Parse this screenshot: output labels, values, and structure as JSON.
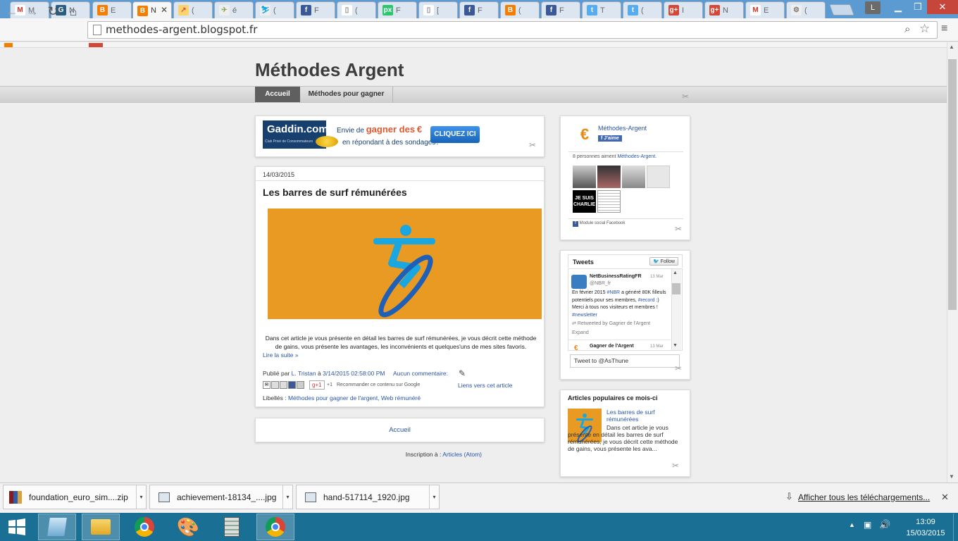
{
  "browser": {
    "tabs": [
      {
        "fav": "gmail-icon",
        "letter": "M",
        "color": "#ffffff",
        "fg": "#d93025",
        "title": "M"
      },
      {
        "fav": "goodreads-icon",
        "letter": "G",
        "color": "#2b5d80",
        "fg": "#fff",
        "title": "N"
      },
      {
        "fav": "blogger-icon",
        "letter": "B",
        "color": "#f57d00",
        "fg": "#fff",
        "title": "E"
      },
      {
        "fav": "blogger-icon",
        "letter": "B",
        "color": "#f57d00",
        "fg": "#fff",
        "title": "N"
      },
      {
        "fav": "chart-icon",
        "letter": "↗",
        "color": "#ffd36b",
        "fg": "#c55",
        "title": "("
      },
      {
        "fav": "plane-icon",
        "letter": "✈",
        "color": "#eee",
        "fg": "#8a6",
        "title": "é"
      },
      {
        "fav": "surf-icon",
        "letter": "⛷",
        "color": "#eee",
        "fg": "#1aa7e0",
        "title": "("
      },
      {
        "fav": "facebook-icon",
        "letter": "f",
        "color": "#3b5998",
        "fg": "#fff",
        "title": "F"
      },
      {
        "fav": "page-icon",
        "letter": "▯",
        "color": "#fff",
        "fg": "#888",
        "title": "("
      },
      {
        "fav": "pixabay-icon",
        "letter": "px",
        "color": "#2ec66d",
        "fg": "#fff",
        "title": "F"
      },
      {
        "fav": "page-icon",
        "letter": "▯",
        "color": "#fff",
        "fg": "#888",
        "title": "["
      },
      {
        "fav": "facebook-icon",
        "letter": "f",
        "color": "#3b5998",
        "fg": "#fff",
        "title": "F"
      },
      {
        "fav": "blogger-icon",
        "letter": "B",
        "color": "#f57d00",
        "fg": "#fff",
        "title": "("
      },
      {
        "fav": "facebook-icon",
        "letter": "f",
        "color": "#3b5998",
        "fg": "#fff",
        "title": "F"
      },
      {
        "fav": "twitter-icon",
        "letter": "t",
        "color": "#55acee",
        "fg": "#fff",
        "title": "T"
      },
      {
        "fav": "twitter-icon",
        "letter": "t",
        "color": "#55acee",
        "fg": "#fff",
        "title": "("
      },
      {
        "fav": "googleplus-icon",
        "letter": "g+",
        "color": "#d34836",
        "fg": "#fff",
        "title": "I"
      },
      {
        "fav": "googleplus-icon",
        "letter": "g+",
        "color": "#d34836",
        "fg": "#fff",
        "title": "N"
      },
      {
        "fav": "gmail-icon",
        "letter": "M",
        "color": "#fff",
        "fg": "#d93025",
        "title": "E"
      },
      {
        "fav": "settings-icon",
        "letter": "⚙",
        "color": "#eee",
        "fg": "#777",
        "title": "("
      }
    ],
    "user_badge": "L",
    "url": "methodes-argent.blogspot.fr"
  },
  "blog": {
    "title": "Méthodes Argent",
    "nav": {
      "home": "Accueil",
      "methods": "Méthodes pour gagner"
    },
    "ad": {
      "brand": "Gaddin.com",
      "tagline": "Club Privé de Consommateurs",
      "line1_prefix": "Envie de ",
      "line1_highlight": "gagner des",
      "line1_euro": "€",
      "line2": "en répondant à des sondages?",
      "button": "CLIQUEZ ICI"
    },
    "post": {
      "date": "14/03/2015",
      "title": "Les barres de surf rémunérées",
      "excerpt": "Dans cet article je vous présente en détail les barres de surf rémunérées, je vous décrit cette méthode de gains, vous présente les avantages, les inconvénients et quelques'uns de mes sites favoris.",
      "read_more": "Lire la suite »",
      "published_by": "Publié par",
      "author": "L. Tristan",
      "at": "à",
      "time": "3/14/2015 02:58:00 PM",
      "comments": "Aucun commentaire:",
      "gplus": "g+1",
      "plus_one": "+1",
      "recommend": "Recommander ce contenu sur Google",
      "links_to": "Liens vers cet article",
      "labels_prefix": "Libellés :",
      "label1": "Méthodes pour gagner de l'argent,",
      "label2": "Web rémunéré"
    },
    "home_link": "Accueil",
    "subscribe_prefix": "Inscription à :",
    "subscribe_link": "Articles (Atom)"
  },
  "sidebar": {
    "fb": {
      "page": "Méthodes-Argent",
      "like": "J'aime",
      "count_text": "8 personnes aiment",
      "count_link": "Méthodes-Argent.",
      "charlie": "JE SUIS CHARLIE",
      "plugin": "Module social Facebook"
    },
    "tweets": {
      "header": "Tweets",
      "follow": "Follow",
      "t1_name": "NetBusinessRatingFR",
      "t1_date": "13 Mar",
      "t1_handle": "@NBR_fr",
      "t1_text_a": "En février 2015",
      "t1_tag1": "#NBR",
      "t1_text_b": "a généré 80K filleuls potentiels pour ses membres,",
      "t1_tag2": "#record",
      ":)": ":)",
      "t1_text_c": "Merci à tous nos visiteurs et membres !",
      "t1_tag3": "#newsletter",
      "retweet": "Retweeted by Gagrier de l'Argent",
      "expand": "Expand",
      "t2_name": "Gagner de l'Argent",
      "t2_date": "13 Mar",
      "input_value": "Tweet to @AsThune"
    },
    "popular": {
      "header": "Articles populaires ce mois-ci",
      "title": "Les barres de surf rémunérées",
      "excerpt": "Dans cet article je vous présente en détail les barres de surf rémunérées, je vous décrit cette méthode de gains, vous présente les ava..."
    }
  },
  "downloads": {
    "items": [
      "foundation_euro_sim....zip",
      "achievement-18134_....jpg",
      "hand-517114_1920.jpg"
    ],
    "show_all": "Afficher tous les téléchargements..."
  },
  "taskbar": {
    "time": "13:09",
    "date": "15/03/2015"
  },
  "colors": {
    "accent": "#2a55a5",
    "orange": "#e99a22",
    "surf_blue": "#1aa7e0"
  }
}
